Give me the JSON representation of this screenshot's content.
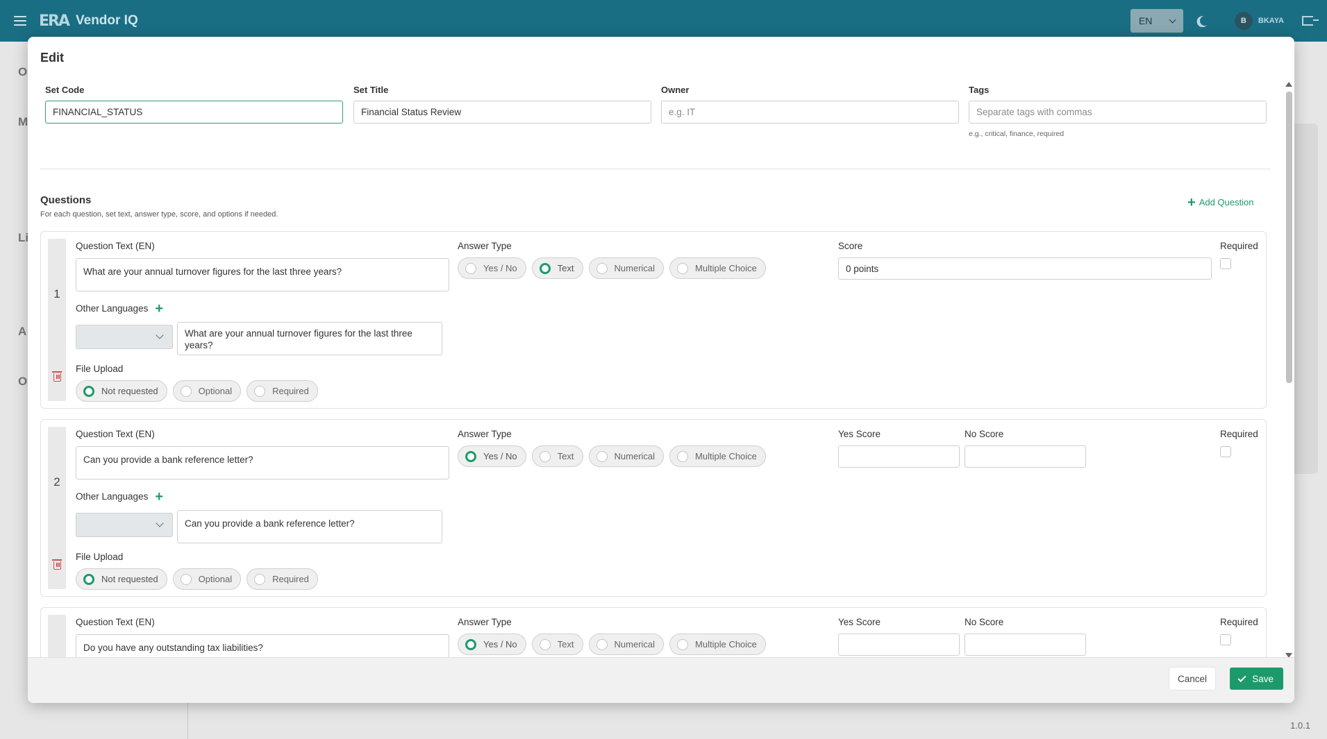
{
  "app": {
    "logo_text": "ERA",
    "title": "Vendor IQ",
    "language": "EN",
    "user_initial": "B",
    "user_name": "BKAYA",
    "version": "1.0.1"
  },
  "background_letters": [
    "O",
    "M",
    "Li",
    "A",
    "O"
  ],
  "modal": {
    "title": "Edit",
    "set_code": {
      "label": "Set Code",
      "value": "FINANCIAL_STATUS"
    },
    "set_title": {
      "label": "Set Title",
      "value": "Financial Status Review"
    },
    "owner": {
      "label": "Owner",
      "value": "",
      "placeholder": "e.g. IT"
    },
    "tags": {
      "label": "Tags",
      "value": "",
      "placeholder": "Separate tags with commas",
      "hint": "e.g., critical, finance, required"
    },
    "questions_section": {
      "title": "Questions",
      "description": "For each question, set text, answer type, score, and options if needed.",
      "add_label": "Add Question"
    },
    "labels": {
      "question_text": "Question Text (EN)",
      "answer_type": "Answer Type",
      "score": "Score",
      "yes_score": "Yes Score",
      "no_score": "No Score",
      "required": "Required",
      "other_languages": "Other Languages",
      "file_upload": "File Upload"
    },
    "answer_types": [
      "Yes / No",
      "Text",
      "Numerical",
      "Multiple Choice"
    ],
    "file_upload_options": [
      "Not requested",
      "Optional",
      "Required"
    ],
    "questions": [
      {
        "number": "1",
        "text": "What are your annual turnover figures for the last three years?",
        "answer_type": "Text",
        "score_value": "0 points",
        "other_language_text": "What are your annual turnover figures for the last three years?",
        "file_upload": "Not requested"
      },
      {
        "number": "2",
        "text": "Can you provide a bank reference letter?",
        "answer_type": "Yes / No",
        "yes_score": "",
        "no_score": "",
        "other_language_text": "Can you provide a bank reference letter?",
        "file_upload": "Not requested"
      },
      {
        "number": "3",
        "text": "Do you have any outstanding tax liabilities?",
        "answer_type": "Yes / No",
        "yes_score": "",
        "no_score": ""
      }
    ],
    "footer": {
      "cancel_label": "Cancel",
      "save_label": "Save"
    }
  },
  "colors": {
    "header": "#1a6e84",
    "accent": "#1d9a6c",
    "danger": "#d45050"
  }
}
